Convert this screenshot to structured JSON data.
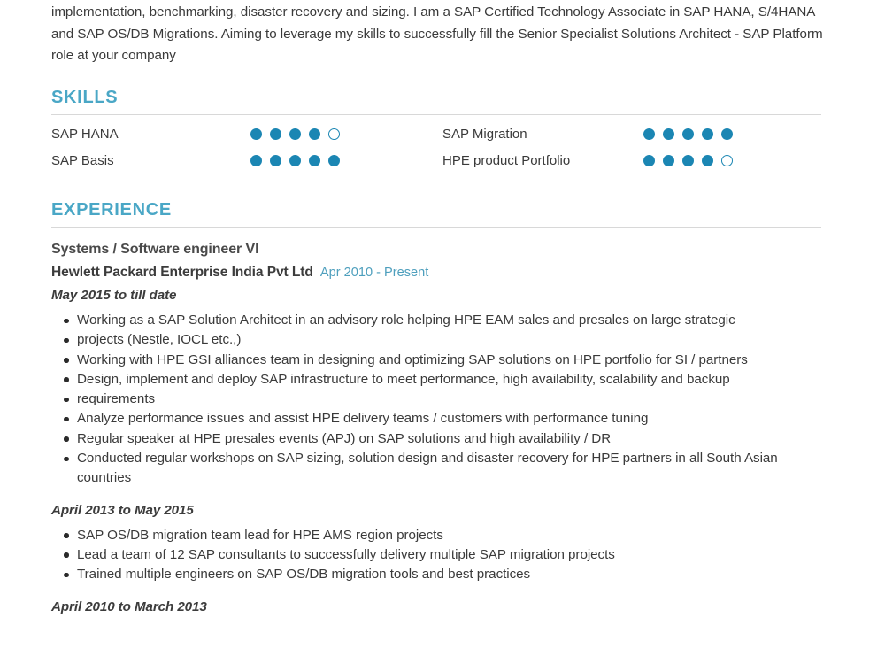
{
  "document": {
    "type": "resume",
    "accent_heading_color": "#4aa7c6",
    "accent_dot_color": "#1b86b3",
    "date_color": "#4e9fbd",
    "body_color": "#3a3a3a",
    "divider_color": "#d8d8d8"
  },
  "summary": {
    "text": "implementation, benchmarking, disaster recovery and sizing. I am a SAP Certified Technology Associate in SAP HANA, S/4HANA and SAP OS/DB Migrations. Aiming to leverage my skills to successfully fill the Senior Specialist Solutions Architect - SAP Platform role at your company"
  },
  "skills": {
    "heading": "SKILLS",
    "max_rating": 5,
    "items": [
      {
        "name": "SAP HANA",
        "rating": 4,
        "column": "left",
        "row": 0
      },
      {
        "name": "SAP Migration",
        "rating": 5,
        "column": "right",
        "row": 0
      },
      {
        "name": "SAP Basis",
        "rating": 5,
        "column": "left",
        "row": 1
      },
      {
        "name": "HPE product Portfolio",
        "rating": 4,
        "column": "right",
        "row": 1
      }
    ]
  },
  "experience": {
    "heading": "EXPERIENCE",
    "job": {
      "title": "Systems / Software engineer VI",
      "company": "Hewlett Packard Enterprise India Pvt Ltd",
      "dates": "Apr 2010 - Present"
    },
    "periods": [
      {
        "label": "May 2015 to till date",
        "bullets": [
          "Working as a SAP Solution Architect in an advisory role helping HPE EAM sales and presales on large strategic",
          "projects (Nestle, IOCL etc.,)",
          "Working with HPE GSI alliances team in designing and optimizing SAP solutions on HPE portfolio for SI / partners",
          "Design, implement and deploy SAP infrastructure to meet performance, high availability, scalability and backup",
          "requirements",
          "Analyze performance issues and assist HPE delivery teams / customers with performance tuning",
          "Regular speaker at HPE presales events (APJ) on SAP solutions and high availability / DR",
          "Conducted regular workshops on SAP sizing, solution design and disaster recovery for HPE partners in all South Asian countries"
        ]
      },
      {
        "label": "April 2013 to May 2015",
        "bullets": [
          "SAP OS/DB migration team lead for HPE AMS region projects",
          "Lead a team of 12 SAP consultants to successfully delivery multiple SAP migration projects",
          "Trained multiple engineers on SAP OS/DB migration tools and best practices"
        ]
      },
      {
        "label": "April 2010 to March 2013",
        "bullets": []
      }
    ]
  }
}
